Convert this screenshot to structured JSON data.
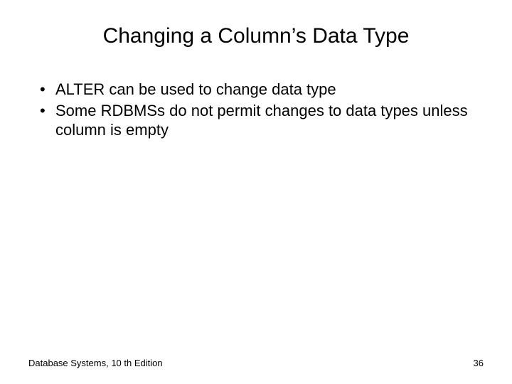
{
  "title": "Changing a Column’s Data Type",
  "bullets": [
    "ALTER can be used to change data type",
    "Some RDBMSs do not permit changes to data types unless column is empty"
  ],
  "footer": {
    "left": "Database Systems, 10 th Edition",
    "right": "36"
  }
}
